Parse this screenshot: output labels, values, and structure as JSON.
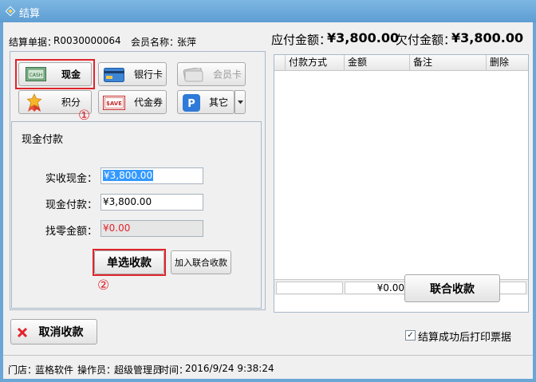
{
  "window": {
    "title": "结算"
  },
  "info": {
    "order_label": "结算单据：",
    "order_value": "R0030000064",
    "member_label": "会员名称：",
    "member_value": "张萍",
    "payable_label": "应付金额：",
    "payable_value": "¥3,800.00",
    "owed_label": "欠付金额：",
    "owed_value": "¥3,800.00"
  },
  "methods": {
    "cash": "现金",
    "bank_card": "银行卡",
    "member_card": "会员卡",
    "points": "积分",
    "voucher": "代金券",
    "voucher_icon_text": "$AVE",
    "other": "其它"
  },
  "annotations": {
    "one": "①",
    "two": "②"
  },
  "cash_panel": {
    "title": "现金付款",
    "received_label": "实收现金：",
    "received_value": "¥3,800.00",
    "payment_label": "现金付款：",
    "payment_value": "¥3,800.00",
    "change_label": "找零金额：",
    "change_value": "¥0.00"
  },
  "actions": {
    "single_pay": "单选收款",
    "add_joint": "加入联合收款",
    "joint_pay": "联合收款",
    "cancel_pay": "取消收款"
  },
  "grid": {
    "columns": [
      "付款方式",
      "金额",
      "备注",
      "删除"
    ],
    "total": "¥0.00"
  },
  "print_option": {
    "label": "结算成功后打印票据",
    "checked": true
  },
  "status": {
    "store_label": "门店：",
    "store_value": "蓝格软件",
    "operator_label": "操作员：",
    "operator_value": "超级管理员",
    "time_label": "时间：",
    "time_value": "2016/9/24 9:38:24"
  },
  "colors": {
    "accent_red": "#e0242b",
    "selection_blue": "#3399ff",
    "titlebar_blue": "#5e9ed3"
  }
}
